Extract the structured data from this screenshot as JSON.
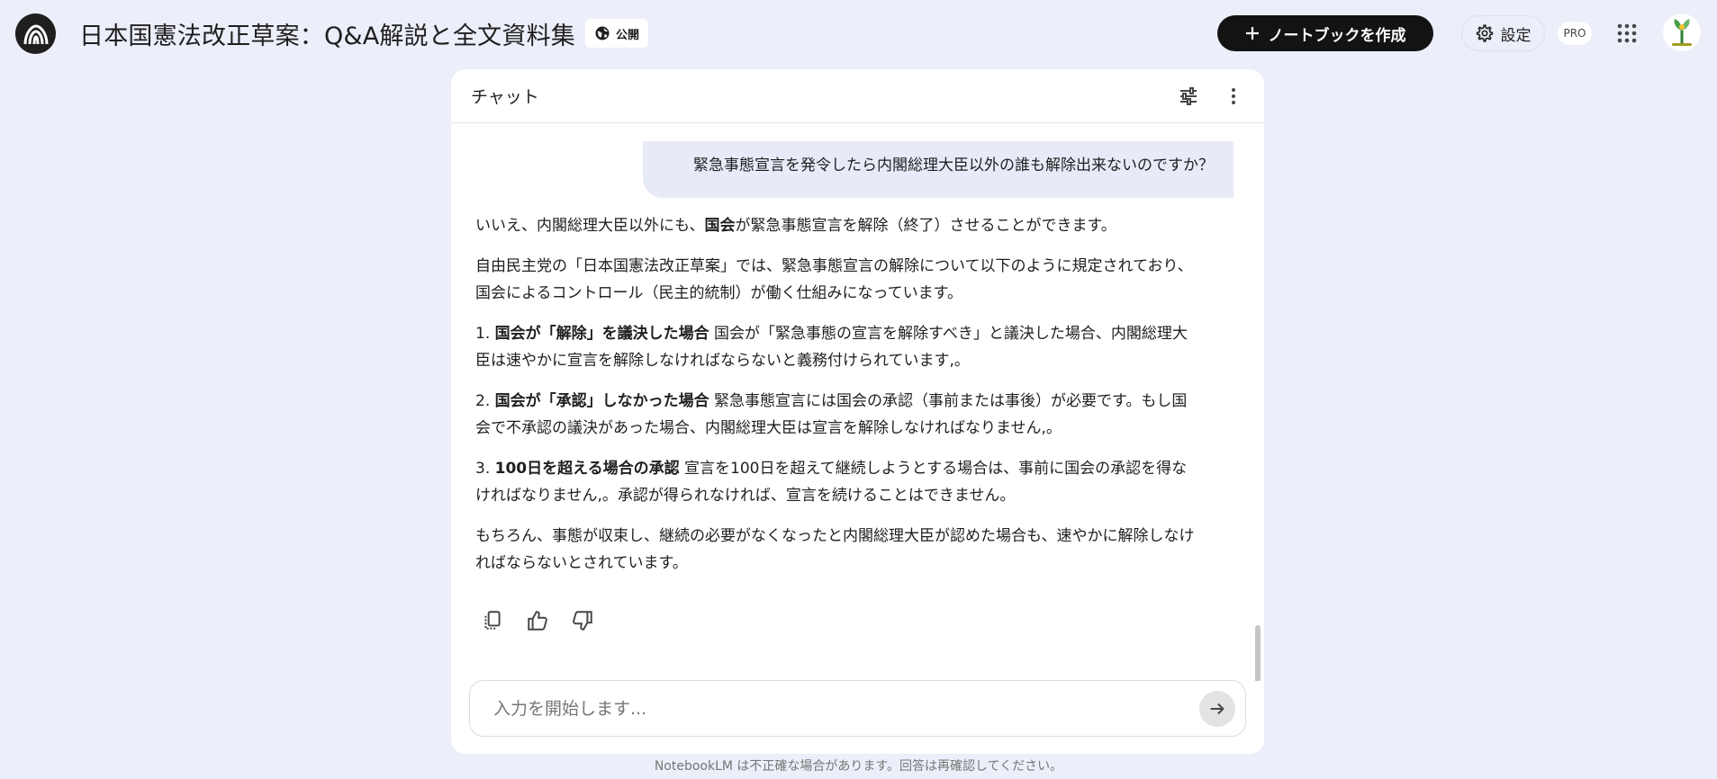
{
  "header": {
    "notebook_title": "日本国憲法改正草案：Q&A解説と全文資料集",
    "public_label": "公開",
    "create_notebook_label": "ノートブックを作成",
    "settings_label": "設定",
    "pro_label": "PRO",
    "icons": {
      "logo": "notebooklm-logo-icon",
      "public": "globe-icon",
      "create": "plus-icon",
      "settings": "gear-icon",
      "apps": "apps-grid-icon",
      "avatar": "avatar-image"
    }
  },
  "chat": {
    "title": "チャット",
    "header_icons": [
      "tune-icon",
      "more-vert-icon"
    ],
    "user_message": "緊急事態宣言を発令したら内閣総理大臣以外の誰も解除出来ないのですか？",
    "answer": {
      "p1_pre": "いいえ、内閣総理大臣以外にも、",
      "p1_bold": "国会",
      "p1_post": "が緊急事態宣言を解除（終了）させることができます。",
      "p2": "自由民主党の「日本国憲法改正草案」では、緊急事態宣言の解除について以下のように規定されており、国会によるコントロール（民主的統制）が働く仕組みになっています。",
      "item1_num": "1.",
      "item1_bold": "国会が「解除」を議決した場合",
      "item1_text": "国会が「緊急事態の宣言を解除すべき」と議決した場合、内閣総理大臣は速やかに宣言を解除しなければならないと義務付けられています,。",
      "item2_num": "2.",
      "item2_bold": "国会が「承認」しなかった場合",
      "item2_text": "緊急事態宣言には国会の承認（事前または事後）が必要です。もし国会で不承認の議決があった場合、内閣総理大臣は宣言を解除しなければなりません,。",
      "item3_num": "3.",
      "item3_bold": "100日を超える場合の承認",
      "item3_text": "宣言を100日を超えて継続しようとする場合は、事前に国会の承認を得なければなりません,。承認が得られなければ、宣言を続けることはできません。",
      "p_last": "もちろん、事態が収束し、継続の必要がなくなったと内閣総理大臣が認めた場合も、速やかに解除しなければならないとされています。"
    },
    "action_icons": [
      "copy-icon",
      "thumbs-up-icon",
      "thumbs-down-icon"
    ],
    "input": {
      "placeholder": "入力を開始します...",
      "value": ""
    }
  },
  "footer": {
    "note": "NotebookLM は不正確な場合があります。回答は再確認してください。"
  },
  "colors": {
    "background": "#eceef9",
    "panel": "#ffffff",
    "user_bubble": "#e7ebf8",
    "primary_button": "#131314"
  }
}
